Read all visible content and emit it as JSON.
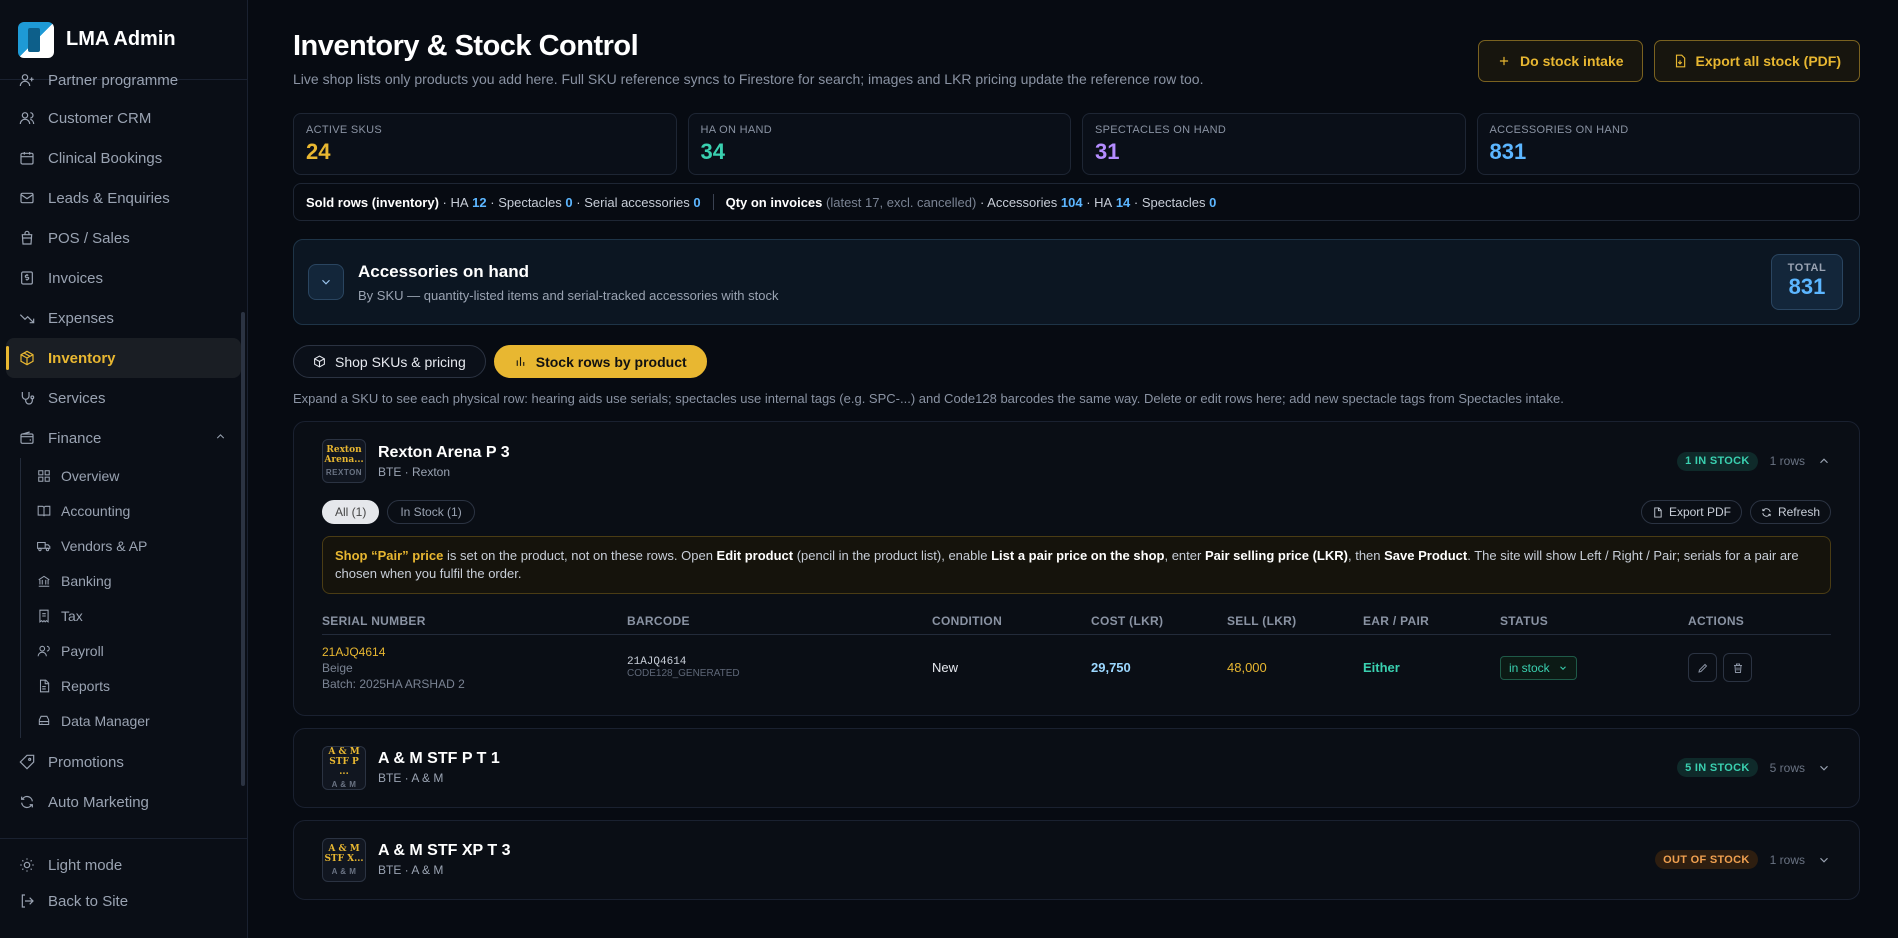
{
  "brand": {
    "name": "LMA Admin"
  },
  "sidebar": {
    "items": [
      {
        "label": "Partner programme",
        "icon": "user-plus-icon"
      },
      {
        "label": "Customer CRM",
        "icon": "users-icon"
      },
      {
        "label": "Clinical Bookings",
        "icon": "calendar-icon"
      },
      {
        "label": "Leads & Enquiries",
        "icon": "mail-icon"
      },
      {
        "label": "POS / Sales",
        "icon": "bag-icon"
      },
      {
        "label": "Invoices",
        "icon": "dollar-icon"
      },
      {
        "label": "Expenses",
        "icon": "trend-down-icon"
      },
      {
        "label": "Inventory",
        "icon": "box-icon",
        "active": true
      },
      {
        "label": "Services",
        "icon": "stethoscope-icon"
      },
      {
        "label": "Finance",
        "icon": "wallet-icon"
      }
    ],
    "finance_sub": [
      {
        "label": "Overview",
        "icon": "grid-icon"
      },
      {
        "label": "Accounting",
        "icon": "book-icon"
      },
      {
        "label": "Vendors & AP",
        "icon": "truck-icon"
      },
      {
        "label": "Banking",
        "icon": "bank-icon"
      },
      {
        "label": "Tax",
        "icon": "receipt-icon"
      },
      {
        "label": "Payroll",
        "icon": "people-icon"
      },
      {
        "label": "Reports",
        "icon": "file-icon"
      },
      {
        "label": "Data Manager",
        "icon": "drive-icon"
      }
    ],
    "after": [
      {
        "label": "Promotions",
        "icon": "tag-icon"
      },
      {
        "label": "Auto Marketing",
        "icon": "refresh-icon"
      }
    ],
    "footer": {
      "light_mode": "Light mode",
      "back": "Back to Site"
    }
  },
  "header": {
    "title": "Inventory & Stock Control",
    "subtitle": "Live shop lists only products you add here. Full SKU reference syncs to Firestore for search; images and LKR pricing update the reference row too.",
    "intake_label": "Do stock intake",
    "export_label": "Export all stock (PDF)"
  },
  "stats": [
    {
      "label": "ACTIVE SKUS",
      "value": "24",
      "color": "#e8b731"
    },
    {
      "label": "HA ON HAND",
      "value": "34",
      "color": "#3ad0b0"
    },
    {
      "label": "SPECTACLES ON HAND",
      "value": "31",
      "color": "#b48cff"
    },
    {
      "label": "ACCESSORIES ON HAND",
      "value": "831",
      "color": "#5cb6ff"
    }
  ],
  "sold": {
    "label": "Sold rows (inventory)",
    "ha_label": "· HA",
    "ha": "12",
    "spec_label": "· Spectacles",
    "spec": "0",
    "serial_label": "· Serial accessories",
    "serial": "0",
    "qty_label": "Qty on invoices",
    "qty_note": "(latest 17, excl. cancelled)",
    "acc_label": "· Accessories",
    "acc": "104",
    "ha2_label": "· HA",
    "ha2": "14",
    "spec2_label": "· Spectacles",
    "spec2": "0"
  },
  "accessories": {
    "title": "Accessories on hand",
    "subtitle": "By SKU — quantity-listed items and serial-tracked accessories with stock",
    "total_label": "TOTAL",
    "total_value": "831"
  },
  "tabs": {
    "shop": "Shop SKUs & pricing",
    "stock": "Stock rows by product"
  },
  "help": "Expand a SKU to see each physical row: hearing aids use serials; spectacles use internal tags (e.g. SPC-...) and Code128 barcodes the same way. Delete or edit rows here; add new spectacle tags from Spectacles intake.",
  "products": [
    {
      "thumb_line1": "Rexton",
      "thumb_line2": "Arena...",
      "thumb_brand": "REXTON",
      "name": "Rexton Arena P 3",
      "meta": "BTE · Rexton",
      "badge": "1 IN STOCK",
      "rows": "1 rows",
      "filters": {
        "all": "All (1)",
        "in_stock": "In Stock (1)"
      },
      "export": "Export PDF",
      "refresh": "Refresh",
      "note": {
        "p1": "Shop “Pair” price",
        "p2": " is set on the product, not on these rows. Open ",
        "p3": "Edit product",
        "p4": " (pencil in the product list), enable ",
        "p5": "List a pair price on the shop",
        "p6": ", enter ",
        "p7": "Pair selling price (LKR)",
        "p8": ", then ",
        "p9": "Save Product",
        "p10": ". The site will show Left / Right / Pair; serials for a pair are chosen when you fulfil the order."
      },
      "columns": [
        "SERIAL NUMBER",
        "BARCODE",
        "CONDITION",
        "COST (LKR)",
        "SELL (LKR)",
        "EAR / PAIR",
        "STATUS",
        "ACTIONS"
      ],
      "row": {
        "serial": "21AJQ4614",
        "color": "Beige",
        "batch": "Batch: 2025HA ARSHAD 2",
        "barcode": "21AJQ4614",
        "barcode_type": "CODE128_GENERATED",
        "condition": "New",
        "cost": "29,750",
        "sell": "48,000",
        "ear": "Either",
        "status": "in stock"
      }
    },
    {
      "thumb_line1": "A & M",
      "thumb_line2": "STF P ...",
      "thumb_brand": "A & M",
      "name": "A & M STF P T 1",
      "meta": "BTE · A & M",
      "badge": "5 IN STOCK",
      "rows": "5 rows"
    },
    {
      "thumb_line1": "A & M",
      "thumb_line2": "STF X...",
      "thumb_brand": "A & M",
      "name": "A & M STF XP T 3",
      "meta": "BTE · A & M",
      "badge": "OUT OF STOCK",
      "rows": "1 rows"
    }
  ]
}
